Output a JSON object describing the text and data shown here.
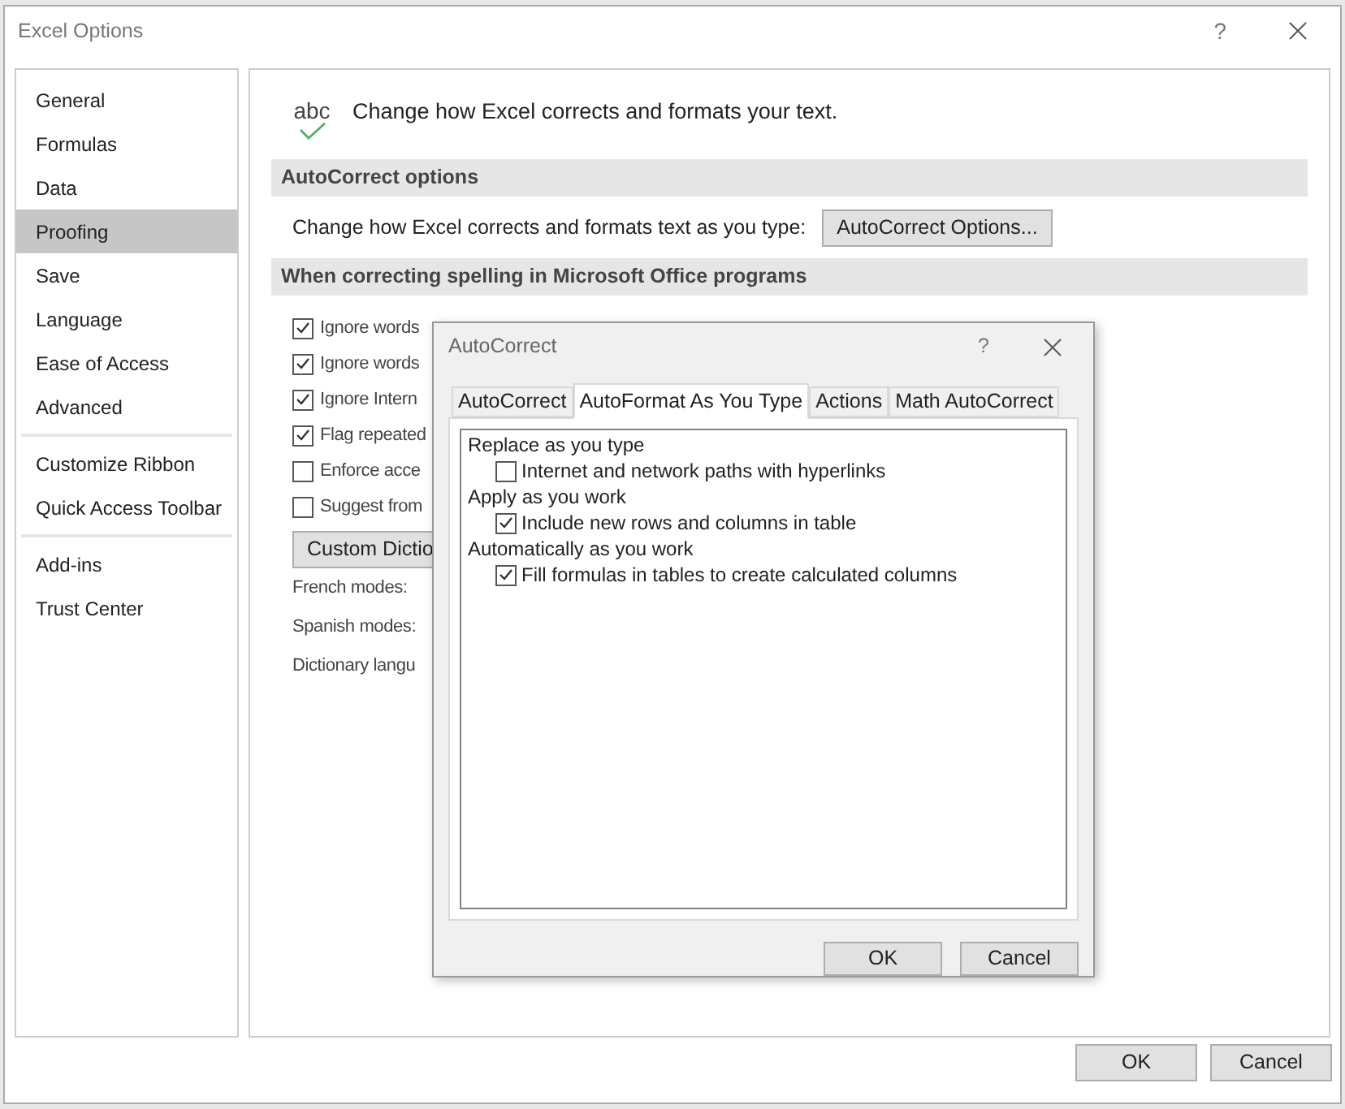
{
  "window": {
    "title": "Excel Options",
    "help": "?"
  },
  "sidebar": {
    "groups": [
      [
        {
          "label": "General",
          "selected": false
        },
        {
          "label": "Formulas",
          "selected": false
        },
        {
          "label": "Data",
          "selected": false
        },
        {
          "label": "Proofing",
          "selected": true
        },
        {
          "label": "Save",
          "selected": false
        },
        {
          "label": "Language",
          "selected": false
        },
        {
          "label": "Ease of Access",
          "selected": false
        },
        {
          "label": "Advanced",
          "selected": false
        }
      ],
      [
        {
          "label": "Customize Ribbon",
          "selected": false
        },
        {
          "label": "Quick Access Toolbar",
          "selected": false
        }
      ],
      [
        {
          "label": "Add-ins",
          "selected": false
        },
        {
          "label": "Trust Center",
          "selected": false
        }
      ]
    ]
  },
  "header": {
    "icon_text": "abc",
    "text": "Change how Excel corrects and formats your text."
  },
  "autocorrect_section": {
    "title": "AutoCorrect options",
    "text": "Change how Excel corrects and formats text as you type:",
    "button": "AutoCorrect Options..."
  },
  "spelling_section": {
    "title": "When correcting spelling in Microsoft Office programs",
    "options": [
      {
        "label": "Ignore words",
        "checked": true
      },
      {
        "label": "Ignore words",
        "checked": true
      },
      {
        "label": "Ignore Intern",
        "checked": true
      },
      {
        "label": "Flag repeated",
        "checked": true
      },
      {
        "label": "Enforce acce",
        "checked": false
      },
      {
        "label": "Suggest from",
        "checked": false
      }
    ],
    "button": "Custom Dictio",
    "fields": [
      "French modes:",
      "Spanish modes:",
      "Dictionary langu"
    ]
  },
  "buttons": [
    "OK",
    "Cancel"
  ],
  "autocorrect_dialog": {
    "title": "AutoCorrect",
    "help": "?",
    "tabs": [
      {
        "label": "AutoCorrect",
        "selected": false
      },
      {
        "label": "AutoFormat As You Type",
        "selected": true
      },
      {
        "label": "Actions",
        "selected": false
      },
      {
        "label": "Math AutoCorrect",
        "selected": false
      }
    ],
    "items": [
      {
        "kind": "heading",
        "label": "Replace as you type"
      },
      {
        "kind": "checkbox",
        "label": "Internet and network paths with hyperlinks",
        "checked": false
      },
      {
        "kind": "heading",
        "label": "Apply as you work"
      },
      {
        "kind": "checkbox",
        "label": "Include new rows and columns in table",
        "checked": true
      },
      {
        "kind": "heading",
        "label": "Automatically as you work"
      },
      {
        "kind": "checkbox",
        "label": "Fill formulas in tables to create calculated columns",
        "checked": true
      }
    ],
    "buttons": [
      "OK",
      "Cancel"
    ]
  }
}
